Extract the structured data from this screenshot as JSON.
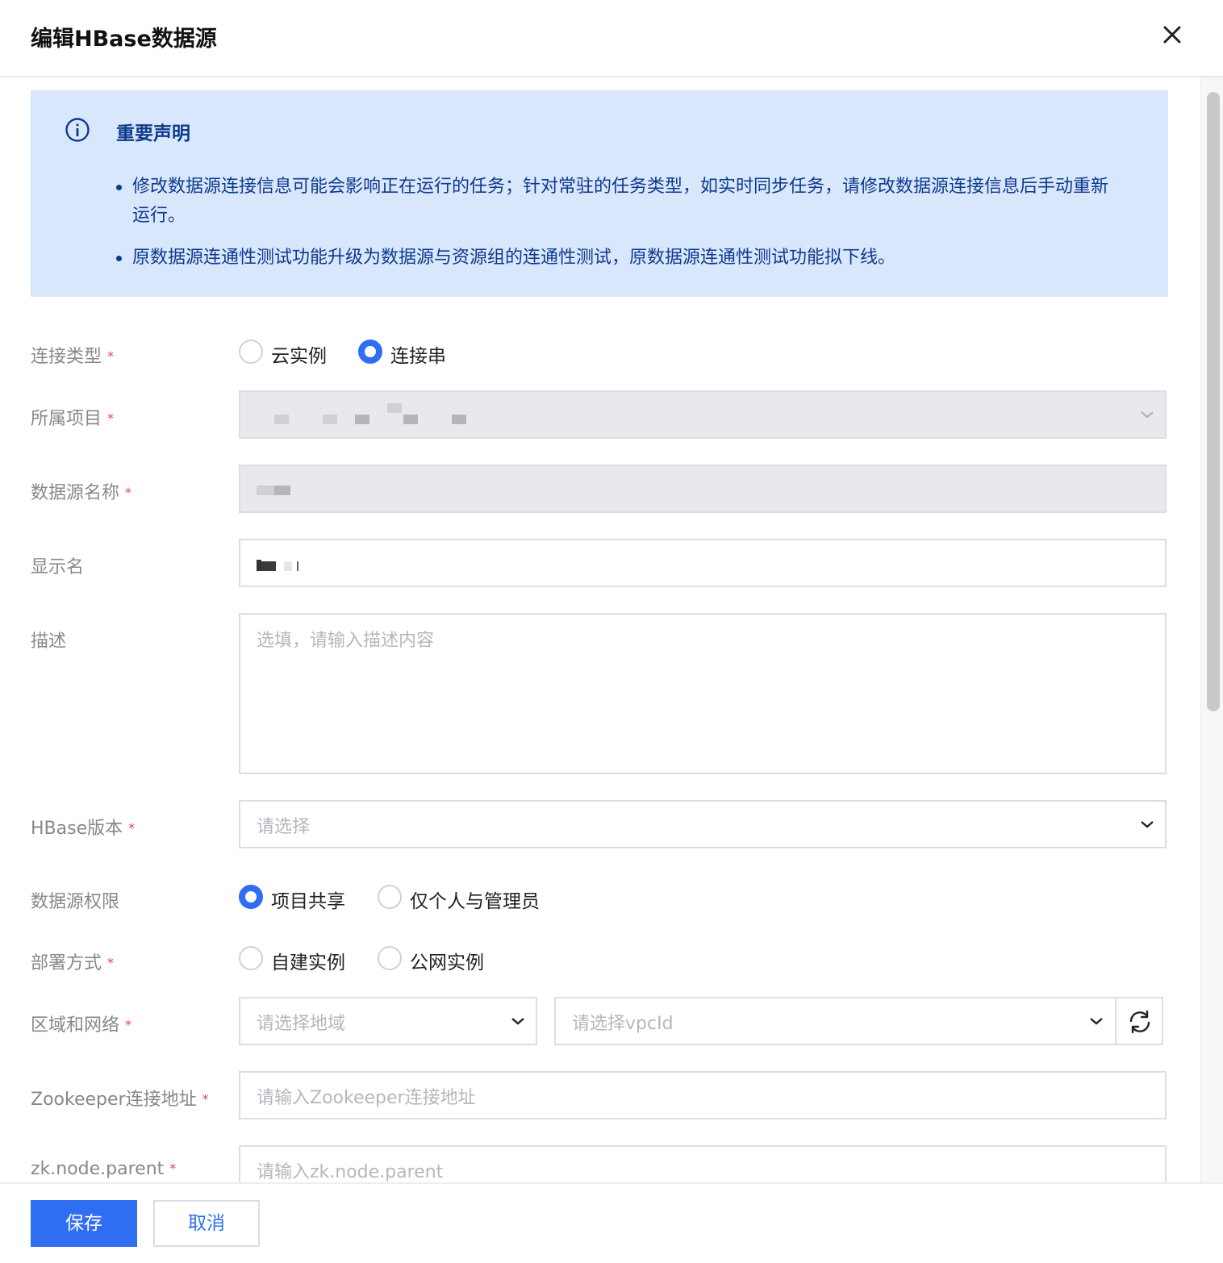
{
  "dialog": {
    "title": "编辑HBase数据源"
  },
  "notice": {
    "title": "重要声明",
    "items": [
      "修改数据源连接信息可能会影响正在运行的任务；针对常驻的任务类型，如实时同步任务，请修改数据源连接信息后手动重新运行。",
      "原数据源连通性测试功能升级为数据源与资源组的连通性测试，原数据源连通性测试功能拟下线。"
    ]
  },
  "form": {
    "connection_type": {
      "label": "连接类型",
      "options": [
        "云实例",
        "连接串"
      ],
      "selected": "连接串"
    },
    "project": {
      "label": "所属项目"
    },
    "datasource_name": {
      "label": "数据源名称"
    },
    "display_name": {
      "label": "显示名"
    },
    "description": {
      "label": "描述",
      "placeholder": "选填，请输入描述内容"
    },
    "hbase_version": {
      "label": "HBase版本",
      "placeholder": "请选择"
    },
    "permission": {
      "label": "数据源权限",
      "options": [
        "项目共享",
        "仅个人与管理员"
      ],
      "selected": "项目共享"
    },
    "deploy_mode": {
      "label": "部署方式",
      "options": [
        "自建实例",
        "公网实例"
      ],
      "selected": ""
    },
    "region_network": {
      "label": "区域和网络",
      "region_placeholder": "请选择地域",
      "vpc_placeholder": "请选择vpcId"
    },
    "zookeeper": {
      "label": "Zookeeper连接地址",
      "placeholder": "请输入Zookeeper连接地址"
    },
    "zk_parent": {
      "label": "zk.node.parent",
      "placeholder": "请输入zk.node.parent"
    },
    "required_mark": "*"
  },
  "footer": {
    "save_label": "保存",
    "cancel_label": "取消"
  },
  "colors": {
    "primary": "#2f6ef0",
    "notice_bg": "#d9e7fd",
    "notice_text": "#0d3a8c",
    "required": "#e54545"
  }
}
